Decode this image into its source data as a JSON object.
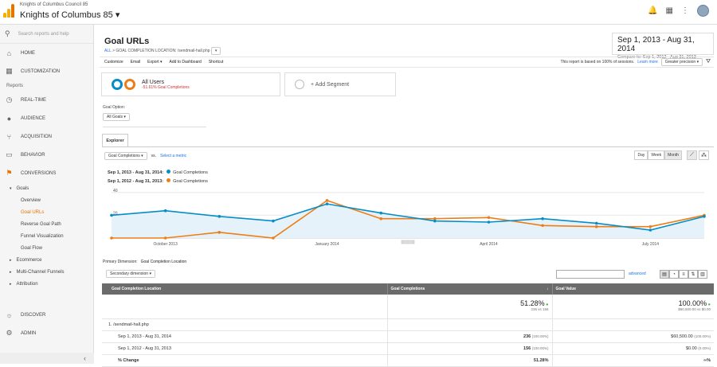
{
  "account": {
    "org": "Knights of Columbus Council 85",
    "property": "Knights of Columbus 85"
  },
  "sidebar": {
    "search_placeholder": "Search reports and help",
    "home": "HOME",
    "customization": "CUSTOMIZATION",
    "reports_header": "Reports",
    "realtime": "REAL-TIME",
    "audience": "AUDIENCE",
    "acquisition": "ACQUISITION",
    "behavior": "BEHAVIOR",
    "conversions": "CONVERSIONS",
    "goals": "Goals",
    "goal_items": [
      "Overview",
      "Goal URLs",
      "Reverse Goal Path",
      "Funnel Visualization",
      "Goal Flow"
    ],
    "ecommerce": "Ecommerce",
    "mcf": "Multi-Channel Funnels",
    "attribution": "Attribution",
    "discover": "DISCOVER",
    "admin": "ADMIN"
  },
  "report": {
    "title": "Goal URLs",
    "crumb_all": "ALL",
    "crumb_rest": "> GOAL COMPLETION LOCATION: /sendmail-hall.php",
    "date_range": "Sep 1, 2013 - Aug 31, 2014",
    "compare": "Compare to: Sep 1, 2012 - Aug 31, 2013",
    "toolbar": [
      "Customize",
      "Email",
      "Export ▾",
      "Add to Dashboard",
      "Shortcut"
    ],
    "sampling_note": "This report is based on 100% of sessions.",
    "learn_more": "Learn more",
    "precision": "Greater precision",
    "segment_name": "All Users",
    "segment_sub": "-51.61% Goal Completions",
    "add_segment": "+ Add Segment",
    "goal_option_label": "Goal Option:",
    "goal_option_value": "All Goals",
    "tab_explorer": "Explorer",
    "metric": "Goal Completions",
    "vs": "vs.",
    "select_metric": "Select a metric",
    "periods": [
      "Day",
      "Week",
      "Month"
    ],
    "legend": [
      {
        "range": "Sep 1, 2013 - Aug 31, 2014:",
        "name": "Goal Completions",
        "color": "#058dc7"
      },
      {
        "range": "Sep 1, 2012 - Aug 31, 2013:",
        "name": "Goal Completions",
        "color": "#ed7e17"
      }
    ],
    "primary_dim_label": "Primary Dimension:",
    "primary_dim_value": "Goal Completion Location",
    "secondary_dim": "Secondary dimension",
    "advanced": "advanced"
  },
  "chart_data": {
    "type": "line",
    "x": [
      "Sep 2013",
      "Oct 2013",
      "Nov 2013",
      "Dec 2013",
      "Jan 2014",
      "Feb 2014",
      "Mar 2014",
      "Apr 2014",
      "May 2014",
      "Jun 2014",
      "Jul 2014",
      "Aug 2014"
    ],
    "x_tick_labels": [
      "October 2013",
      "January 2014",
      "April 2014",
      "July 2014"
    ],
    "y_ticks": [
      20,
      40
    ],
    "ylim": [
      0,
      42
    ],
    "series": [
      {
        "name": "Goal Completions",
        "period": "Sep 1, 2013 - Aug 31, 2014",
        "color": "#058dc7",
        "values": [
          20,
          24,
          19,
          15,
          30,
          22,
          15,
          14,
          17,
          13,
          7,
          19
        ]
      },
      {
        "name": "Goal Completions",
        "period": "Sep 1, 2012 - Aug 31, 2013",
        "color": "#ed7e17",
        "values": [
          0,
          0,
          5,
          0,
          33,
          17,
          17,
          18,
          11,
          10,
          10,
          20
        ]
      }
    ]
  },
  "table": {
    "headers": [
      "Goal Completion Location",
      "Goal Completions",
      "Goal Value"
    ],
    "totals": {
      "completions_pct": "51.28%",
      "completions_sub": "236 vs 156",
      "value_pct": "100.00%",
      "value_sub": "$60,500.00 vs $0.00"
    },
    "rows": [
      {
        "label": "1.   /sendmail-hall.php",
        "c1": "",
        "c1p": "",
        "c2": "",
        "c2p": ""
      },
      {
        "label": "Sep 1, 2013 - Aug 31, 2014",
        "c1": "236",
        "c1p": "(100.00%)",
        "c2": "$60,500.00",
        "c2p": "(100.00%)"
      },
      {
        "label": "Sep 1, 2012 - Aug 31, 2013",
        "c1": "156",
        "c1p": "(100.00%)",
        "c2": "$0.00",
        "c2p": "(0.00%)"
      },
      {
        "label": "% Change",
        "c1": "51.28%",
        "c1p": "",
        "c2": "∞%",
        "c2p": ""
      }
    ]
  }
}
